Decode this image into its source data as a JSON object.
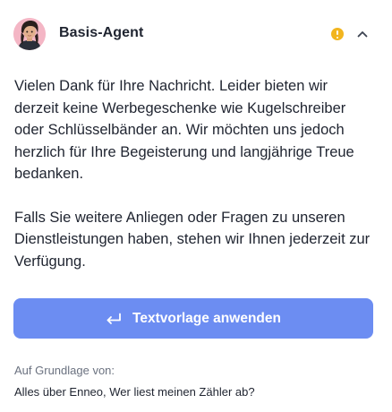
{
  "header": {
    "agent_name": "Basis-Agent",
    "avatar_icon": "agent-avatar",
    "status_icon": "warning-dot-icon",
    "status_color": "#f2b51f",
    "collapse_icon": "chevron-up-icon"
  },
  "message": {
    "paragraphs": [
      "Vielen Dank für Ihre Nachricht. Leider bieten wir derzeit keine Werbegeschenke wie Kugelschreiber oder Schlüsselbänder an. Wir möchten uns jedoch herzlich für Ihre Begeisterung und langjährige Treue bedanken.",
      "Falls Sie weitere Anliegen oder Fragen zu unseren Dienstleistungen haben, stehen wir Ihnen jederzeit zur Verfügung."
    ]
  },
  "actions": {
    "apply_label": "Textvorlage anwenden",
    "apply_icon": "enter-return-icon",
    "button_color": "#6c8df2"
  },
  "source": {
    "label": "Auf Grundlage von:",
    "article_title": "Alles über Enneo, Wer liest meinen Zähler ab?"
  }
}
